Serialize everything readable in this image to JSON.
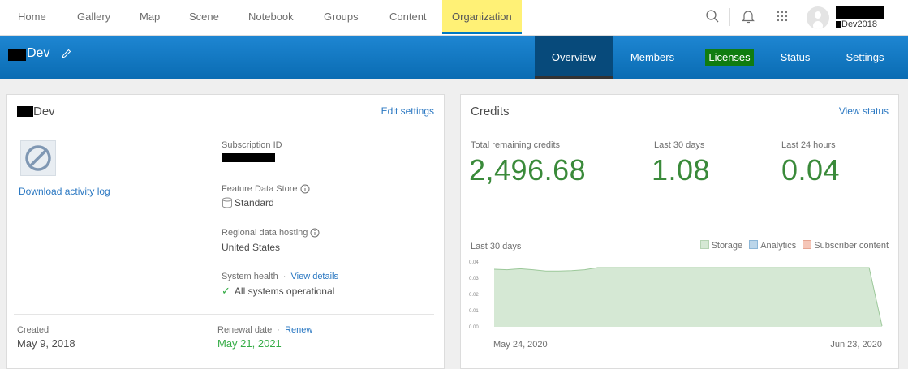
{
  "nav": {
    "items": [
      "Home",
      "Gallery",
      "Map",
      "Scene",
      "Notebook",
      "Groups",
      "Content",
      "Organization"
    ],
    "user_suffix": "Dev2018"
  },
  "header": {
    "org_name": "Dev",
    "tabs": [
      "Overview",
      "Members",
      "Licenses",
      "Status",
      "Settings"
    ]
  },
  "org_card": {
    "title": "Dev",
    "edit_link": "Edit settings",
    "download_link": "Download activity log",
    "subscription_label": "Subscription ID",
    "feature_store_label": "Feature Data Store",
    "feature_store_value": "Standard",
    "regional_label": "Regional data hosting",
    "regional_value": "United States",
    "health_label": "System health",
    "health_link": "View details",
    "health_value": "All systems operational",
    "created_label": "Created",
    "created_value": "May 9, 2018",
    "renewal_label": "Renewal date",
    "renew_link": "Renew",
    "renewal_value": "May 21, 2021"
  },
  "credits_card": {
    "title": "Credits",
    "view_status_link": "View status",
    "total_label": "Total remaining credits",
    "total_value": "2,496.68",
    "last30_label": "Last 30 days",
    "last30_value": "1.08",
    "last24_label": "Last 24 hours",
    "last24_value": "0.04",
    "chart_label": "Last 30 days",
    "legend": [
      "Storage",
      "Analytics",
      "Subscriber content"
    ],
    "x_start": "May 24, 2020",
    "x_end": "Jun 23, 2020",
    "colors": {
      "storage": "#d5e8d4",
      "storage_line": "#9cc89a",
      "analytics": "#bcd6ea",
      "subscriber": "#f5c6b8"
    }
  },
  "chart_data": {
    "type": "area",
    "xlabel": "",
    "ylabel": "",
    "ylim": [
      0,
      0.04
    ],
    "y_ticks": [
      "0.04",
      "0.03",
      "0.02",
      "0.01",
      "0.00"
    ],
    "x_labels": [
      "May 24, 2020",
      "Jun 23, 2020"
    ],
    "series": [
      {
        "name": "Storage",
        "values": [
          0.0355,
          0.0352,
          0.0358,
          0.0352,
          0.0344,
          0.0344,
          0.0346,
          0.0352,
          0.0365,
          0.0365,
          0.0365,
          0.0365,
          0.0365,
          0.0365,
          0.0365,
          0.0365,
          0.0365,
          0.0365,
          0.0365,
          0.0365,
          0.0365,
          0.0365,
          0.0365,
          0.0365,
          0.0365,
          0.0365,
          0.0365,
          0.0365,
          0.0365,
          0.0365,
          0.0005
        ]
      }
    ],
    "legend": "top-right"
  }
}
